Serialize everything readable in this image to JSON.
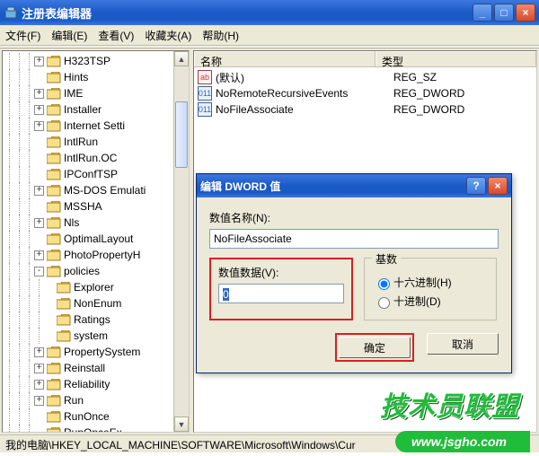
{
  "window_title": "注册表编辑器",
  "menu": {
    "file": "文件(F)",
    "edit": "编辑(E)",
    "view": "查看(V)",
    "favorites": "收藏夹(A)",
    "help": "帮助(H)"
  },
  "tree": [
    {
      "indent": 3,
      "twisty": "+",
      "label": "H323TSP"
    },
    {
      "indent": 3,
      "twisty": "",
      "label": "Hints"
    },
    {
      "indent": 3,
      "twisty": "+",
      "label": "IME"
    },
    {
      "indent": 3,
      "twisty": "+",
      "label": "Installer"
    },
    {
      "indent": 3,
      "twisty": "+",
      "label": "Internet Setti"
    },
    {
      "indent": 3,
      "twisty": "",
      "label": "IntlRun"
    },
    {
      "indent": 3,
      "twisty": "",
      "label": "IntlRun.OC"
    },
    {
      "indent": 3,
      "twisty": "",
      "label": "IPConfTSP"
    },
    {
      "indent": 3,
      "twisty": "+",
      "label": "MS-DOS Emulati"
    },
    {
      "indent": 3,
      "twisty": "",
      "label": "MSSHA"
    },
    {
      "indent": 3,
      "twisty": "+",
      "label": "Nls"
    },
    {
      "indent": 3,
      "twisty": "",
      "label": "OptimalLayout"
    },
    {
      "indent": 3,
      "twisty": "+",
      "label": "PhotoPropertyH"
    },
    {
      "indent": 3,
      "twisty": "-",
      "label": "policies"
    },
    {
      "indent": 4,
      "twisty": "",
      "label": "Explorer"
    },
    {
      "indent": 4,
      "twisty": "",
      "label": "NonEnum"
    },
    {
      "indent": 4,
      "twisty": "",
      "label": "Ratings"
    },
    {
      "indent": 4,
      "twisty": "",
      "label": "system"
    },
    {
      "indent": 3,
      "twisty": "+",
      "label": "PropertySystem"
    },
    {
      "indent": 3,
      "twisty": "+",
      "label": "Reinstall"
    },
    {
      "indent": 3,
      "twisty": "+",
      "label": "Reliability"
    },
    {
      "indent": 3,
      "twisty": "+",
      "label": "Run"
    },
    {
      "indent": 3,
      "twisty": "",
      "label": "RunOnce"
    },
    {
      "indent": 3,
      "twisty": "",
      "label": "RunOnceEx"
    }
  ],
  "list": {
    "header_name": "名称",
    "header_type": "类型",
    "rows": [
      {
        "icon": "str",
        "name": "(默认)",
        "type": "REG_SZ"
      },
      {
        "icon": "bin",
        "name": "NoRemoteRecursiveEvents",
        "type": "REG_DWORD"
      },
      {
        "icon": "bin",
        "name": "NoFileAssociate",
        "type": "REG_DWORD"
      }
    ]
  },
  "statusbar": "我的电脑\\HKEY_LOCAL_MACHINE\\SOFTWARE\\Microsoft\\Windows\\Cur",
  "dialog": {
    "title": "编辑 DWORD 值",
    "name_label": "数值名称(N):",
    "name_value": "NoFileAssociate",
    "data_label": "数值数据(V):",
    "data_value": "0",
    "base_legend": "基数",
    "hex_label": "十六进制(H)",
    "dec_label": "十进制(D)",
    "ok": "确定",
    "cancel": "取消"
  },
  "watermark": {
    "text1": "技术员联盟",
    "text2": "www.jsgho.com"
  }
}
